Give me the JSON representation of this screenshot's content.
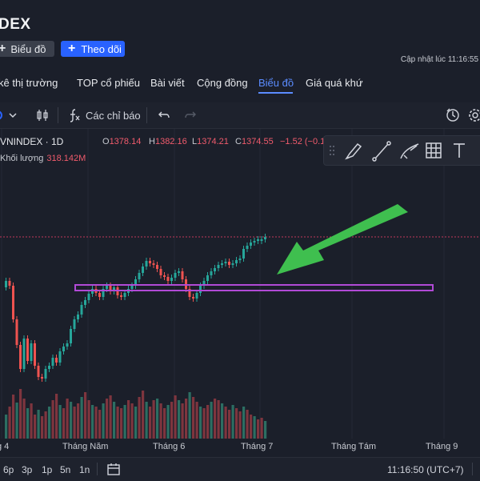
{
  "header": {
    "title": "DEX",
    "chart_button": "Biểu đồ",
    "follow_button": "Theo dõi",
    "updated": "Cập nhật lúc  11:16:55"
  },
  "nav": {
    "items": [
      {
        "label": "kê thị trường"
      },
      {
        "label": "TOP cổ phiếu"
      },
      {
        "label": "Bài viết"
      },
      {
        "label": "Cộng đồng"
      },
      {
        "label": "Biểu đồ",
        "active": true
      },
      {
        "label": "Giá quá khứ"
      }
    ]
  },
  "toolbar": {
    "indicators": "Các chỉ báo",
    "icons": [
      "chevron-down-icon",
      "candles-icon",
      "fx-icon",
      "undo-icon",
      "redo-icon",
      "alert-icon",
      "gear-icon"
    ]
  },
  "legend": {
    "symbol": "VNINDEX · 1D",
    "o_label": "O",
    "o_value": "1378.14",
    "h_label": "H",
    "h_value": "1382.16",
    "l_label": "L",
    "l_value": "1374.21",
    "c_label": "C",
    "c_value": "1374.55",
    "change": "−1.52 (−0.1",
    "volume_label": "Khối lượng",
    "volume_value": "318.142M"
  },
  "drawing_tools": [
    "drag-handle-icon",
    "brush-icon",
    "trend-line-icon",
    "curve-icon",
    "grid-icon",
    "text-icon"
  ],
  "xaxis": {
    "labels": [
      "g 4",
      "Tháng Năm",
      "Tháng 6",
      "Tháng 7",
      "Tháng Tám",
      "Tháng 9"
    ]
  },
  "bottom": {
    "timeframes": [
      "6p",
      "3p",
      "1p",
      "5n",
      "1n"
    ],
    "clock": "11:16:50 (UTC+7)"
  },
  "colors": {
    "up": "#26a69a",
    "down": "#ef5350",
    "zone": "#b14ad6",
    "arrow": "#3fbf4f",
    "accent": "#2962ff"
  }
}
